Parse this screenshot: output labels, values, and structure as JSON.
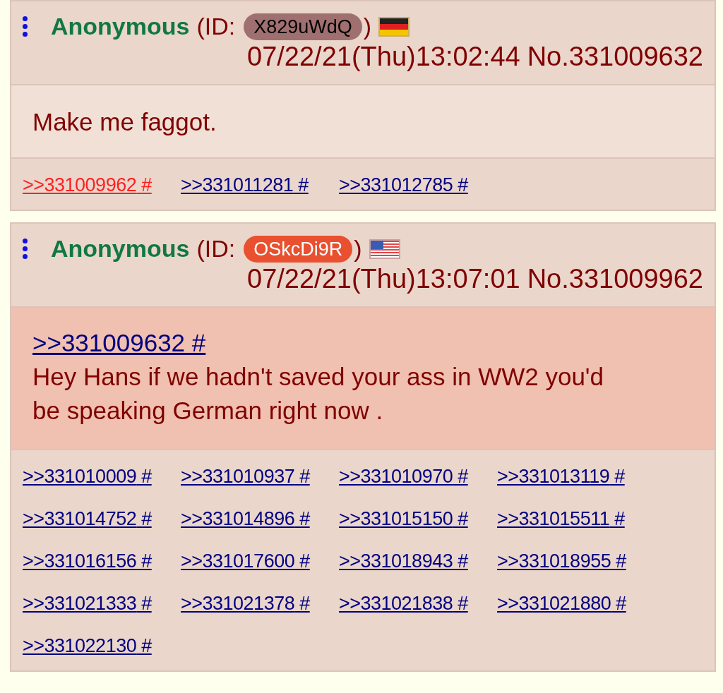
{
  "posts": [
    {
      "name": "Anonymous",
      "id_open": "(ID:",
      "id": "X829uWdQ",
      "color": "#a07070",
      "id_dark_text": true,
      "id_close": ")",
      "flag": {
        "kind": "de"
      },
      "datetime": "07/22/21(Thu)13:02:44",
      "number": "No.331009632",
      "highlighted": false,
      "text": "Make me faggot.",
      "replies": [
        {
          "label": ">>331009962",
          "hash": "#",
          "highlighted": true
        },
        {
          "label": ">>331011281",
          "hash": "#",
          "highlighted": false
        },
        {
          "label": ">>331012785",
          "hash": "#",
          "highlighted": false
        }
      ]
    },
    {
      "name": "Anonymous",
      "id_open": "(ID:",
      "id": "OSkcDi9R",
      "color": "#e8502f",
      "id_dark_text": false,
      "id_close": ")",
      "flag": {
        "kind": "us"
      },
      "datetime": "07/22/21(Thu)13:07:01",
      "number": "No.331009962",
      "highlighted": true,
      "quote": {
        "label": ">>331009632",
        "hash": "#"
      },
      "text": "Hey Hans if we hadn't saved your ass in WW2 you'd be speaking German right now .",
      "replies": [
        {
          "label": ">>331010009",
          "hash": "#",
          "highlighted": false
        },
        {
          "label": ">>331010937",
          "hash": "#",
          "highlighted": false
        },
        {
          "label": ">>331010970",
          "hash": "#",
          "highlighted": false
        },
        {
          "label": ">>331013119",
          "hash": "#",
          "highlighted": false
        },
        {
          "label": ">>331014752",
          "hash": "#",
          "highlighted": false
        },
        {
          "label": ">>331014896",
          "hash": "#",
          "highlighted": false
        },
        {
          "label": ">>331015150",
          "hash": "#",
          "highlighted": false
        },
        {
          "label": ">>331015511",
          "hash": "#",
          "highlighted": false
        },
        {
          "label": ">>331016156",
          "hash": "#",
          "highlighted": false
        },
        {
          "label": ">>331017600",
          "hash": "#",
          "highlighted": false
        },
        {
          "label": ">>331018943",
          "hash": "#",
          "highlighted": false
        },
        {
          "label": ">>331018955",
          "hash": "#",
          "highlighted": false
        },
        {
          "label": ">>331021333",
          "hash": "#",
          "highlighted": false
        },
        {
          "label": ">>331021378",
          "hash": "#",
          "highlighted": false
        },
        {
          "label": ">>331021838",
          "hash": "#",
          "highlighted": false
        },
        {
          "label": ">>331021880",
          "hash": "#",
          "highlighted": false
        },
        {
          "label": ">>331022130",
          "hash": "#",
          "highlighted": false
        }
      ]
    }
  ]
}
